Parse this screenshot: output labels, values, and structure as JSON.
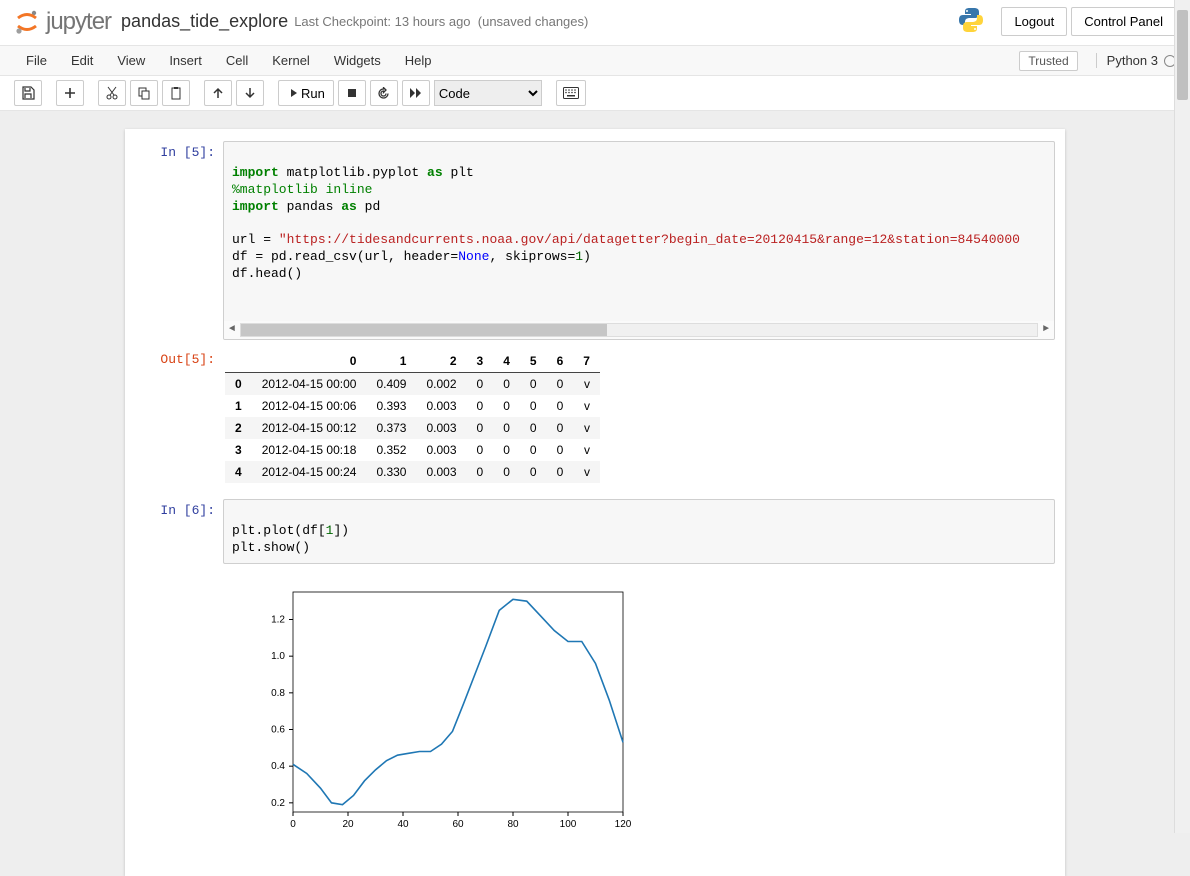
{
  "header": {
    "brand": "jupyter",
    "notebook_name": "pandas_tide_explore",
    "checkpoint": "Last Checkpoint: 13 hours ago",
    "autosave": "(unsaved changes)",
    "logout": "Logout",
    "control_panel": "Control Panel"
  },
  "menu": {
    "items": [
      "File",
      "Edit",
      "View",
      "Insert",
      "Cell",
      "Kernel",
      "Widgets",
      "Help"
    ],
    "trusted": "Trusted",
    "kernel": "Python 3"
  },
  "toolbar": {
    "run": "Run",
    "celltype": "Code",
    "icons": {
      "save": "save-icon",
      "add": "plus-icon",
      "cut": "scissors-icon",
      "copy": "copy-icon",
      "paste": "paste-icon",
      "up": "arrow-up-icon",
      "down": "arrow-down-icon",
      "stop": "stop-icon",
      "restart": "rotate-icon",
      "restart_run": "fast-forward-icon",
      "keyboard": "keyboard-icon"
    }
  },
  "cell5": {
    "in_prompt": "In [5]:",
    "out_prompt": "Out[5]:",
    "code": {
      "l1a": "import",
      "l1b": " matplotlib.pyplot ",
      "l1c": "as",
      "l1d": " plt",
      "l2": "%matplotlib inline",
      "l3a": "import",
      "l3b": " pandas ",
      "l3c": "as",
      "l3d": " pd",
      "l5a": "url = ",
      "l5b": "\"https://tidesandcurrents.noaa.gov/api/datagetter?begin_date=20120415&range=12&station=84540000",
      "l6a": "df = pd.read_csv(url, header=",
      "l6b": "None",
      "l6c": ", skiprows=",
      "l6d": "1",
      "l6e": ")",
      "l7": "df.head()"
    },
    "table": {
      "cols": [
        "0",
        "1",
        "2",
        "3",
        "4",
        "5",
        "6",
        "7"
      ],
      "rows": [
        {
          "i": "0",
          "c": [
            "2012-04-15 00:00",
            "0.409",
            "0.002",
            "0",
            "0",
            "0",
            "0",
            "v"
          ]
        },
        {
          "i": "1",
          "c": [
            "2012-04-15 00:06",
            "0.393",
            "0.003",
            "0",
            "0",
            "0",
            "0",
            "v"
          ]
        },
        {
          "i": "2",
          "c": [
            "2012-04-15 00:12",
            "0.373",
            "0.003",
            "0",
            "0",
            "0",
            "0",
            "v"
          ]
        },
        {
          "i": "3",
          "c": [
            "2012-04-15 00:18",
            "0.352",
            "0.003",
            "0",
            "0",
            "0",
            "0",
            "v"
          ]
        },
        {
          "i": "4",
          "c": [
            "2012-04-15 00:24",
            "0.330",
            "0.003",
            "0",
            "0",
            "0",
            "0",
            "v"
          ]
        }
      ]
    }
  },
  "cell6": {
    "in_prompt": "In [6]:",
    "code": {
      "l1a": "plt.plot(df[",
      "l1b": "1",
      "l1c": "])",
      "l2": "plt.show()"
    }
  },
  "chart_data": {
    "type": "line",
    "title": "",
    "xlabel": "",
    "ylabel": "",
    "xticks": [
      0,
      20,
      40,
      60,
      80,
      100,
      120
    ],
    "yticks": [
      0.2,
      0.4,
      0.6,
      0.8,
      1.0,
      1.2
    ],
    "xlim": [
      0,
      120
    ],
    "ylim": [
      0.15,
      1.35
    ],
    "series": [
      {
        "name": "df[1]",
        "x": [
          0,
          5,
          10,
          14,
          18,
          22,
          26,
          30,
          34,
          38,
          42,
          46,
          50,
          54,
          58,
          62,
          70,
          75,
          80,
          85,
          90,
          95,
          100,
          105,
          110,
          115,
          120
        ],
        "y": [
          0.41,
          0.36,
          0.28,
          0.2,
          0.19,
          0.24,
          0.32,
          0.38,
          0.43,
          0.46,
          0.47,
          0.48,
          0.48,
          0.52,
          0.59,
          0.74,
          1.05,
          1.25,
          1.31,
          1.3,
          1.22,
          1.14,
          1.08,
          1.08,
          0.96,
          0.76,
          0.53
        ]
      }
    ]
  }
}
